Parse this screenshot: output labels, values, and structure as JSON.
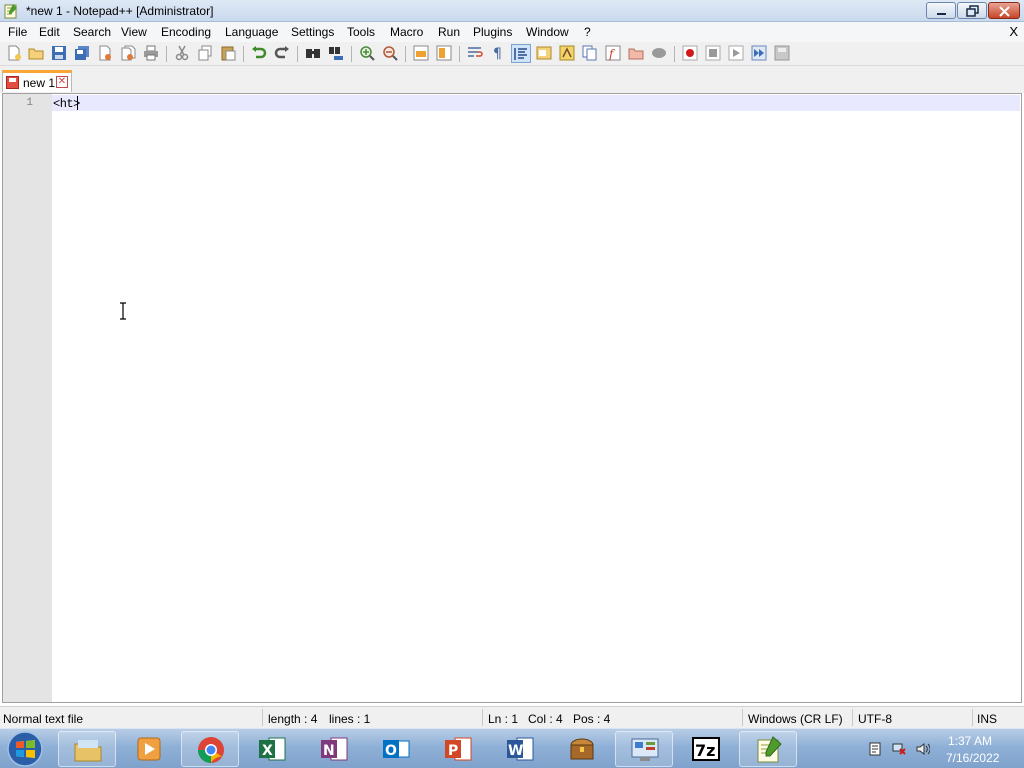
{
  "window": {
    "title": "*new 1 - Notepad++ [Administrator]"
  },
  "menubar": {
    "items": [
      "File",
      "Edit",
      "Search",
      "View",
      "Encoding",
      "Language",
      "Settings",
      "Tools",
      "Macro",
      "Run",
      "Plugins",
      "Window",
      "?"
    ],
    "close_label": "X"
  },
  "tabs": [
    {
      "label": "new 1",
      "modified": true
    }
  ],
  "editor": {
    "line_number": "1",
    "line_text": "<ht>"
  },
  "statusbar": {
    "file_type": "Normal text file",
    "length": "length : 4",
    "lines": "lines : 1",
    "ln": "Ln : 1",
    "col": "Col : 4",
    "pos": "Pos : 4",
    "eol": "Windows (CR LF)",
    "encoding": "UTF-8",
    "mode": "INS"
  },
  "taskbar": {
    "apps": [
      "windows-explorer",
      "media-player",
      "chrome",
      "excel",
      "onenote",
      "outlook",
      "powerpoint",
      "word",
      "chest-app",
      "control-panel",
      "7-zip",
      "notepad-plus-plus"
    ],
    "active_app": "notepad-plus-plus",
    "clock": {
      "time": "1:37 AM",
      "date": "7/16/2022"
    }
  },
  "colors": {
    "accent_tab": "#f9a637",
    "current_line": "#e8e8ff",
    "gutter": "#e4e4e4"
  }
}
